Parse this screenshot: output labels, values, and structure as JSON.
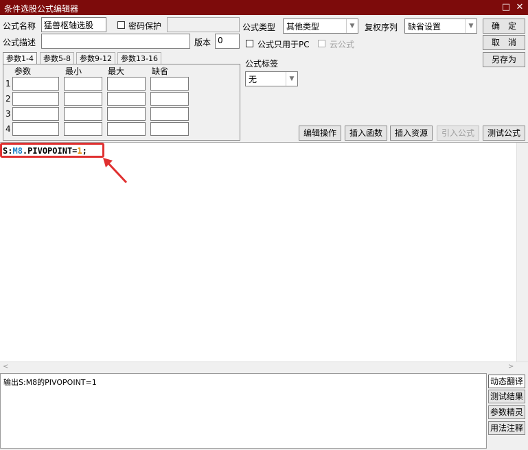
{
  "window": {
    "title": "条件选股公式编辑器",
    "maximize_icon": "□",
    "close_icon": "✕"
  },
  "form": {
    "name_label": "公式名称",
    "name_value": "猛兽枢轴选股",
    "password_label": "密码保护",
    "desc_label": "公式描述",
    "desc_value": "",
    "version_label": "版本",
    "version_value": "0",
    "type_label": "公式类型",
    "type_value": "其他类型",
    "rights_label": "复权序列",
    "rights_value": "缺省设置",
    "pc_only_label": "公式只用于PC",
    "cloud_label": "云公式",
    "tag_label": "公式标签",
    "tag_value": "无"
  },
  "buttons": {
    "ok": "确　定",
    "cancel": "取　消",
    "save_as": "另存为"
  },
  "tabs": [
    "参数1-4",
    "参数5-8",
    "参数9-12",
    "参数13-16"
  ],
  "params": {
    "headers": [
      "参数",
      "最小",
      "最大",
      "缺省"
    ],
    "rows": [
      "1",
      "2",
      "3",
      "4"
    ]
  },
  "toolbar": {
    "edit_ops": "编辑操作",
    "insert_func": "插入函数",
    "insert_resource": "插入资源",
    "import_formula": "引入公式",
    "test_formula": "测试公式"
  },
  "editor": {
    "code": {
      "name": "S",
      "sep": ":",
      "arg": "M8",
      "func": ".PIVOPOINT=",
      "num": "1",
      "end": ";"
    },
    "highlight_color": "#e03030"
  },
  "output": {
    "text": "输出S:M8的PIVOPOINT=1"
  },
  "side_buttons": [
    "动态翻译",
    "测试结果",
    "参数精灵",
    "用法注释"
  ]
}
